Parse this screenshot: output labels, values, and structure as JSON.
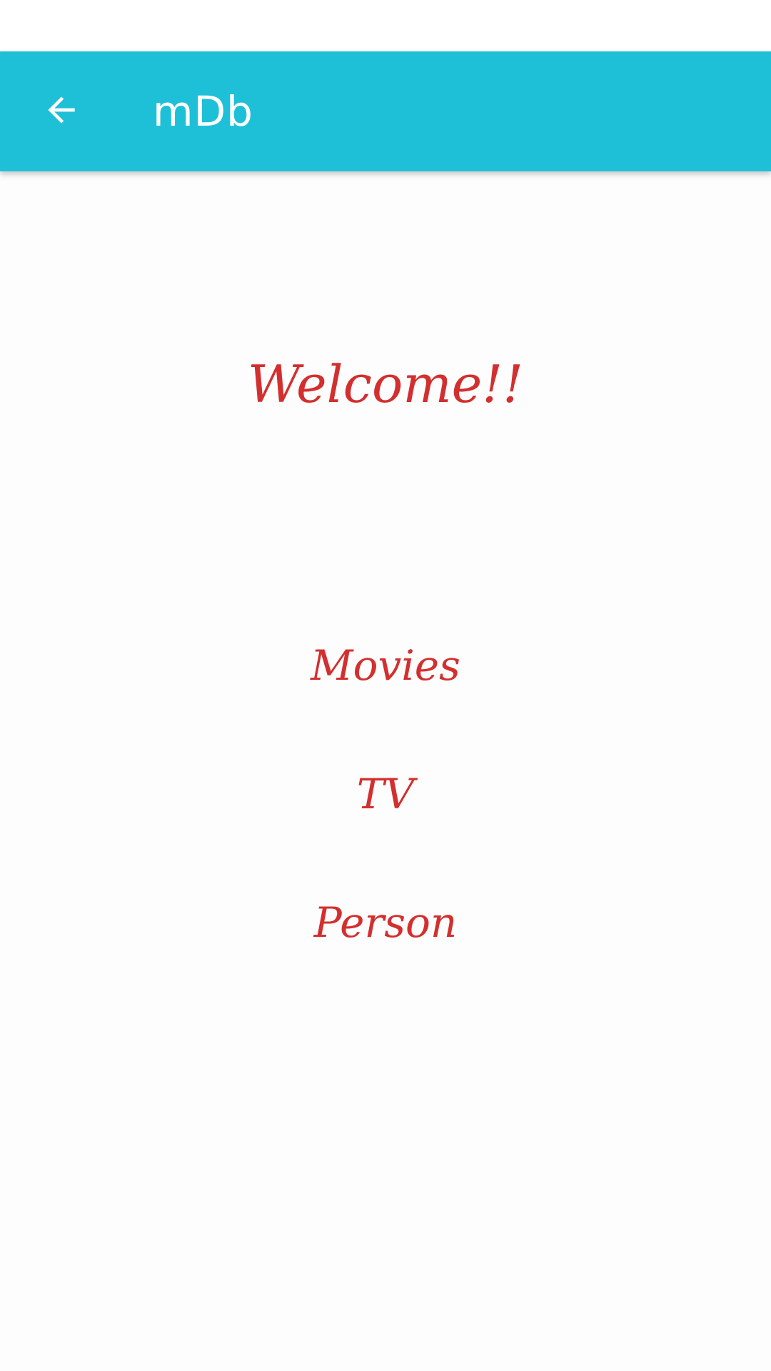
{
  "app_bar": {
    "title": "mDb",
    "back_icon": "arrow-left-icon",
    "background_color": "#1ec0d8",
    "text_color": "#ffffff"
  },
  "main": {
    "welcome_text": "Welcome!!",
    "text_color": "#d32f2f",
    "menu": [
      {
        "label": "Movies"
      },
      {
        "label": "TV"
      },
      {
        "label": "Person"
      }
    ]
  }
}
